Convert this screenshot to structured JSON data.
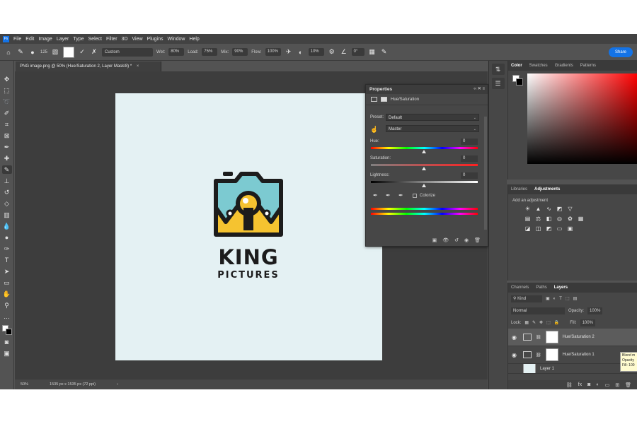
{
  "menubar": {
    "logo": "Ps",
    "items": [
      "File",
      "Edit",
      "Image",
      "Layer",
      "Type",
      "Select",
      "Filter",
      "3D",
      "View",
      "Plugins",
      "Window",
      "Help"
    ]
  },
  "options": {
    "brush_size": "125",
    "preset": "Custom",
    "wet_label": "Wet:",
    "wet_value": "80%",
    "load_label": "Load:",
    "load_value": "75%",
    "mix_label": "Mix:",
    "mix_value": "90%",
    "flow_label": "Flow:",
    "flow_value": "100%",
    "smoothing_value": "10%",
    "angle_value": "0°",
    "share_label": "Share"
  },
  "document": {
    "tab_title": "PNG image.png @ 50% (Hue/Saturation 2, Layer Mask/8) *",
    "close_glyph": "×"
  },
  "canvas": {
    "logo_title": "KING",
    "logo_subtitle": "PICTURES",
    "background_color": "#e4f1f3"
  },
  "statusbar": {
    "zoom": "50%",
    "doc_info": "1535 px x 1535 px (72 ppi)",
    "arrow": "›"
  },
  "properties": {
    "panel_title": "Properties",
    "adjustment_name": "Hue/Saturation",
    "preset_label": "Preset:",
    "preset_value": "Default",
    "channel_value": "Master",
    "hue_label": "Hue:",
    "hue_value": "0",
    "saturation_label": "Saturation:",
    "saturation_value": "0",
    "lightness_label": "Lightness:",
    "lightness_value": "0",
    "colorize_label": "Colorize"
  },
  "color_panel": {
    "tabs": [
      "Color",
      "Swatches",
      "Gradients",
      "Patterns"
    ]
  },
  "adjustments_panel": {
    "tabs": [
      "Libraries",
      "Adjustments"
    ],
    "title": "Add an adjustment"
  },
  "layers_panel": {
    "tabs": [
      "Channels",
      "Paths",
      "Layers"
    ],
    "filter_label": "Kind",
    "blend_mode": "Normal",
    "opacity_label": "Opacity:",
    "opacity_value": "100%",
    "lock_label": "Lock:",
    "fill_label": "Fill:",
    "fill_value": "100%",
    "layers": [
      {
        "name": "Hue/Saturation 2"
      },
      {
        "name": "Hue/Saturation 1"
      },
      {
        "name": "Layer 1"
      }
    ],
    "tooltip": "Blend m Opacity Fill: 100"
  }
}
